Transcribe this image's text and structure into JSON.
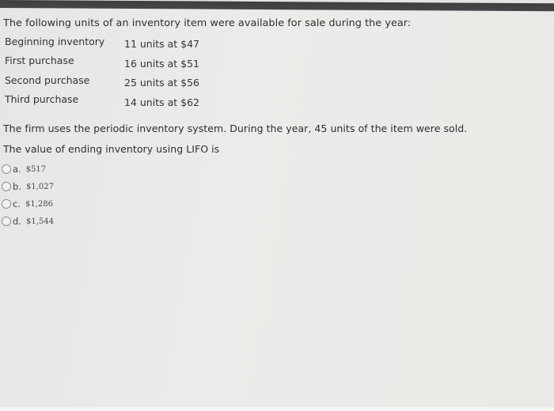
{
  "question": {
    "intro": "The following units of an inventory item were available for sale during the year:",
    "inventory_rows": [
      {
        "label": "Beginning inventory",
        "value": "11 units at $47"
      },
      {
        "label": "First purchase",
        "value": "16 units at $51"
      },
      {
        "label": "Second purchase",
        "value": "25 units at $56"
      },
      {
        "label": "Third purchase",
        "value": "14 units at $62"
      }
    ],
    "description": "The firm uses the periodic inventory system. During the year, 45 units of the item were sold.",
    "prompt": "The value of ending inventory using LIFO is",
    "options": [
      {
        "letter": "a.",
        "value": "$517"
      },
      {
        "letter": "b.",
        "value": "$1,027"
      },
      {
        "letter": "c.",
        "value": "$1,286"
      },
      {
        "letter": "d.",
        "value": "$1,544"
      }
    ]
  }
}
